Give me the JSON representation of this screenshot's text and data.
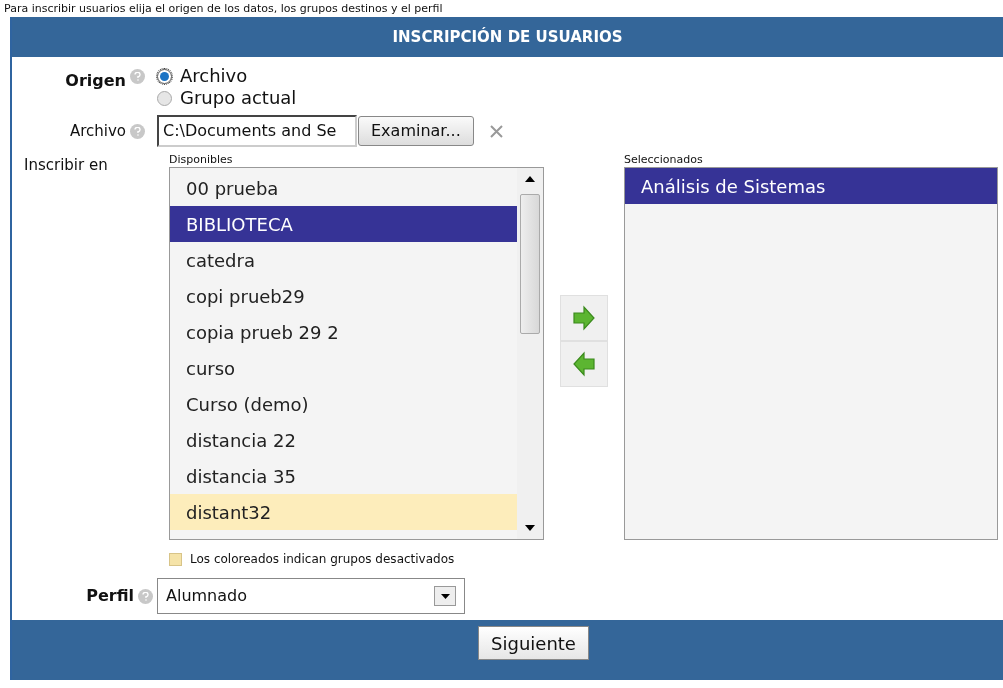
{
  "instructions": "Para inscribir usuarios elija el origen de los datos, los grupos destinos y el perfil",
  "panel": {
    "title": "INSCRIPCIÓN DE USUARIOS"
  },
  "origin": {
    "label": "Origen",
    "options": [
      {
        "label": "Archivo",
        "selected": true
      },
      {
        "label": "Grupo actual",
        "selected": false
      }
    ]
  },
  "file": {
    "label": "Archivo",
    "value": "C:\\Documents and Se",
    "browse_button": "Examinar..."
  },
  "enroll": {
    "label": "Inscribir en",
    "available_label": "Disponibles",
    "selected_label": "Seleccionados",
    "available": [
      {
        "name": "00 prueba",
        "selected": false,
        "disabled": false
      },
      {
        "name": "BIBLIOTECA",
        "selected": true,
        "disabled": false
      },
      {
        "name": "catedra",
        "selected": false,
        "disabled": false
      },
      {
        "name": "copi prueb29",
        "selected": false,
        "disabled": false
      },
      {
        "name": "copia prueb 29 2",
        "selected": false,
        "disabled": false
      },
      {
        "name": "curso",
        "selected": false,
        "disabled": false
      },
      {
        "name": "Curso (demo)",
        "selected": false,
        "disabled": false
      },
      {
        "name": "distancia 22",
        "selected": false,
        "disabled": false
      },
      {
        "name": "distancia 35",
        "selected": false,
        "disabled": false
      },
      {
        "name": "distant32",
        "selected": false,
        "disabled": true
      }
    ],
    "chosen": [
      {
        "name": "Análisis de Sistemas",
        "selected": true
      }
    ],
    "legend": "Los coloreados indican grupos desactivados"
  },
  "profile": {
    "label": "Perfil",
    "value": "Alumnado"
  },
  "next_button": "Siguiente"
}
